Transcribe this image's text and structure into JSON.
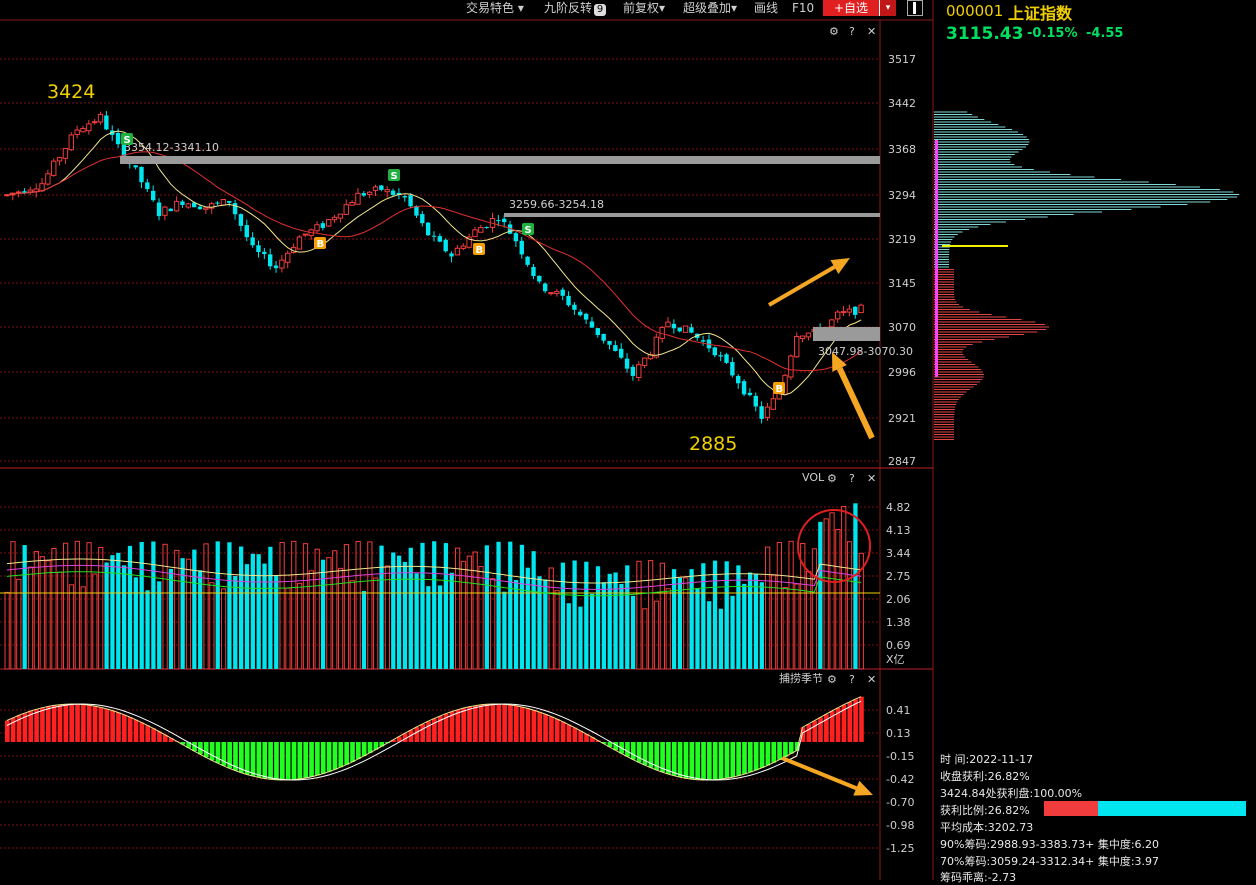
{
  "toolbar": {
    "items": [
      "交易特色 ▾",
      "九阶反转",
      "前复权▾",
      "超级叠加▾",
      "画线",
      "F10"
    ],
    "jiujie_badge": "9",
    "add_watch": "+自选",
    "add_watch_arrow": "▾"
  },
  "quote": {
    "code": "000001",
    "name": "上证指数",
    "price": "3115.43",
    "pct": "-0.15%",
    "change": "-4.55"
  },
  "main_chart": {
    "y_ticks": [
      "3517",
      "3442",
      "3368",
      "3294",
      "3219",
      "3145",
      "3070",
      "2996",
      "2921",
      "2847"
    ],
    "high_label": "3424",
    "low_label": "2885",
    "zones": [
      "3354.12-3341.10",
      "3259.66-3254.18",
      "3047.98-3070.30"
    ],
    "signal_s": "S",
    "signal_b": "B"
  },
  "vol_panel": {
    "title": "VOL",
    "y_ticks": [
      "4.82",
      "4.13",
      "3.44",
      "2.75",
      "2.06",
      "1.38",
      "0.69"
    ],
    "unit": "X亿"
  },
  "ind_panel": {
    "title": "捕捞季节",
    "y_ticks": [
      "0.41",
      "0.13",
      "-0.15",
      "-0.42",
      "-0.70",
      "-0.98",
      "-1.25"
    ]
  },
  "chip_info": {
    "time": "时        间:2022-11-17",
    "profit": "收盘获利:26.82%",
    "profit_at": "3424.84处获利盘:100.00%",
    "ratio_label": "获利比例:26.82%",
    "avg_cost": "平均成本:3202.73",
    "chip90": "90%筹码:2988.93-3383.73+  集中度:6.20",
    "chip70": "70%筹码:3059.24-3312.34+  集中度:3.97",
    "chip_extra": "筹码乖离:-2.73",
    "profit_ratio": 0.2682
  },
  "colors": {
    "up": "#f03c3c",
    "down": "#00e5ee",
    "arrow": "#f5a623",
    "grid": "#7a1010"
  }
}
